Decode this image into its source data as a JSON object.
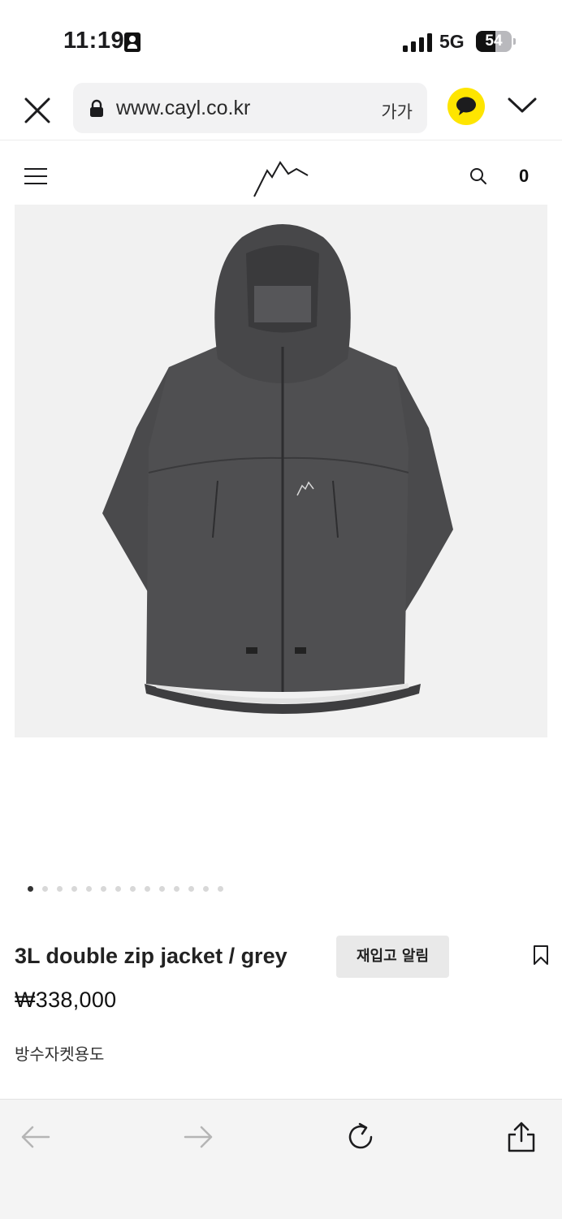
{
  "status_bar": {
    "time": "11:19",
    "network": "5G",
    "battery": "54",
    "battery_level": 0.54
  },
  "browser": {
    "url": "www.cayl.co.kr",
    "reader_label": "가가"
  },
  "site": {
    "cart_count": "0"
  },
  "gallery": {
    "total_images": 14,
    "current_index": 0
  },
  "product": {
    "title": "3L double zip jacket / grey",
    "restock_label": "재입고 알림",
    "price": "₩338,000",
    "description": "방수자켓용도"
  },
  "colors": {
    "kakao_yellow": "#fee500",
    "jacket_grey": "#4a4a4c",
    "image_background": "#f1f1f1",
    "toolbar_background": "#f4f4f4"
  },
  "icons": [
    "person-badge-icon",
    "signal-icon",
    "battery-icon",
    "close-icon",
    "lock-icon",
    "kakao-chat-icon",
    "chevron-down-icon",
    "hamburger-menu-icon",
    "cayl-logo",
    "search-icon",
    "bookmark-icon",
    "back-arrow-icon",
    "forward-arrow-icon",
    "reload-icon",
    "share-icon"
  ]
}
